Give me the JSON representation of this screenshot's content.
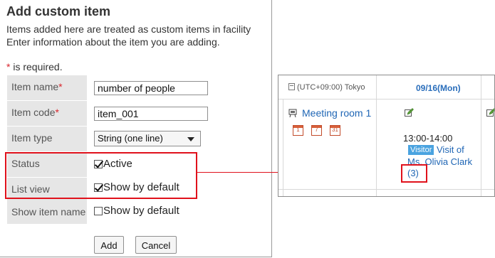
{
  "form": {
    "title": "Add custom item",
    "description_line1": "Items added here are treated as custom items in facility",
    "description_line2": "Enter information about the item you are adding.",
    "required_mark": "*",
    "required_note": " is required.",
    "fields": {
      "item_name": {
        "label": "Item name",
        "required_mark": "*",
        "value": "number of people"
      },
      "item_code": {
        "label": "Item code",
        "required_mark": "*",
        "value": "item_001"
      },
      "item_type": {
        "label": "Item type",
        "selected": "String (one line)"
      },
      "status": {
        "label": "Status",
        "checkbox_label": "Active",
        "checked": true
      },
      "list_view": {
        "label": "List view",
        "checkbox_label": "Show by default",
        "checked": true
      },
      "show_item_name": {
        "label": "Show item name",
        "checkbox_label": "Show by default",
        "checked": false
      }
    },
    "buttons": {
      "add": "Add",
      "cancel": "Cancel"
    }
  },
  "schedule_view": {
    "timezone": "(UTC+09:00) Tokyo",
    "date_header": "09/16(Mon)",
    "facility_name": "Meeting room 1",
    "calendar_icons": [
      "1",
      "7",
      "31"
    ],
    "event": {
      "time": "13:00-14:00",
      "badge": "Visitor",
      "title_line1": "Visit of",
      "title_line2": "Ms. Olivia Clark",
      "custom_value": "(3)"
    }
  },
  "colors": {
    "highlight": "#e0111b",
    "link": "#1f66b5",
    "label_bg": "#e6e6e6",
    "visitor_badge": "#4aa3e0"
  }
}
